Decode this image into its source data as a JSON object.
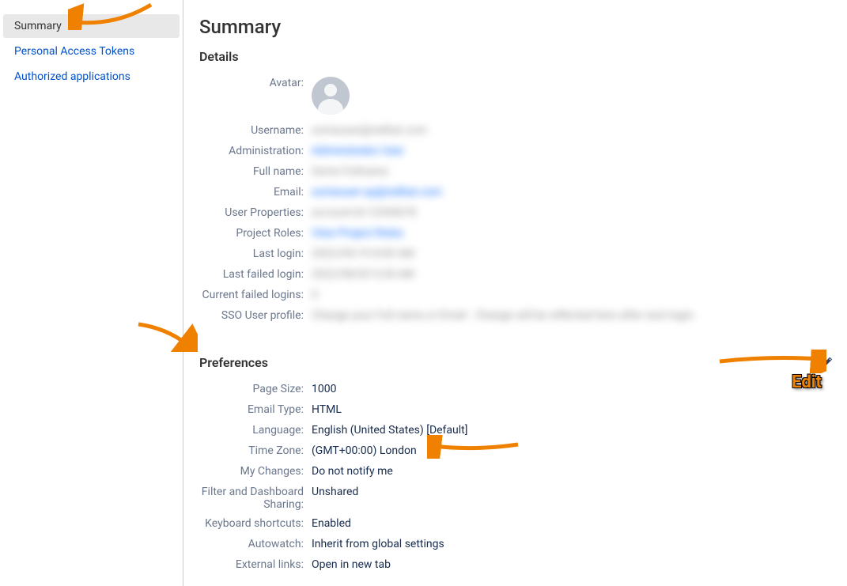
{
  "sidebar": {
    "items": [
      {
        "label": "Summary",
        "active": true
      },
      {
        "label": "Personal Access Tokens",
        "active": false
      },
      {
        "label": "Authorized applications",
        "active": false
      }
    ]
  },
  "page": {
    "title": "Summary"
  },
  "details": {
    "heading": "Details",
    "rows": {
      "avatar_label": "Avatar:",
      "username_label": "Username:",
      "administration_label": "Administration:",
      "fullname_label": "Full name:",
      "email_label": "Email:",
      "userprops_label": "User Properties:",
      "projectroles_label": "Project Roles:",
      "lastlogin_label": "Last login:",
      "lastfailed_label": "Last failed login:",
      "currentfailed_label": "Current failed logins:",
      "sso_label": "SSO User profile:"
    }
  },
  "preferences": {
    "heading": "Preferences",
    "rows": {
      "pagesize_label": "Page Size:",
      "pagesize_value": "1000",
      "emailtype_label": "Email Type:",
      "emailtype_value": "HTML",
      "language_label": "Language:",
      "language_value": "English (United States) [Default]",
      "timezone_label": "Time Zone:",
      "timezone_value": "(GMT+00:00) London",
      "mychanges_label": "My Changes:",
      "mychanges_value": "Do not notify me",
      "filtershare_label": "Filter and Dashboard Sharing:",
      "filtershare_value": "Unshared",
      "keyboard_label": "Keyboard shortcuts:",
      "keyboard_value": "Enabled",
      "autowatch_label": "Autowatch:",
      "autowatch_value": "Inherit from global settings",
      "extlinks_label": "External links:",
      "extlinks_value": "Open in new tab"
    }
  },
  "annotations": {
    "edit_label": "Edit"
  }
}
